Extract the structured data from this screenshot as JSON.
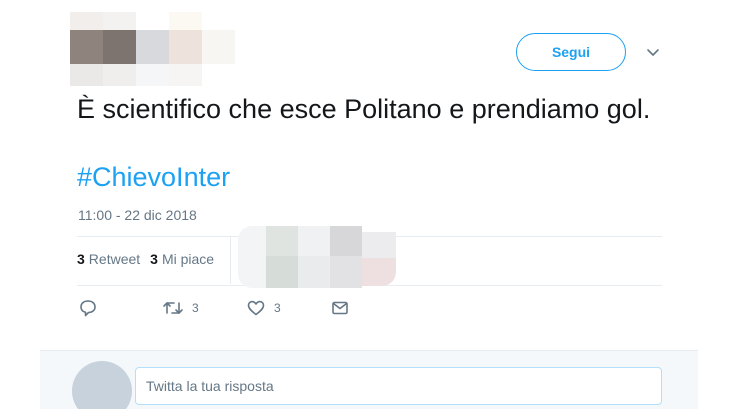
{
  "header": {
    "follow_label": "Segui",
    "caret_icon": "chevron-down-icon"
  },
  "tweet": {
    "text": "È scientifico che esce Politano e prendiamo gol.",
    "hashtag": "#ChievoInter",
    "timestamp": "11:00 - 22 dic 2018"
  },
  "stats": {
    "retweets_count": "3",
    "retweets_label": "Retweet",
    "likes_count": "3",
    "likes_label": "Mi piace"
  },
  "actions": {
    "reply_icon": "reply-icon",
    "retweet_icon": "retweet-icon",
    "retweet_count": "3",
    "like_icon": "heart-icon",
    "like_count": "3",
    "dm_icon": "envelope-icon"
  },
  "reply": {
    "placeholder": "Twitta la tua risposta"
  },
  "colors": {
    "accent": "#1da1f2",
    "text": "#14171a",
    "muted": "#657786",
    "divider": "#e6ecf0",
    "reply_bg": "#f5f8fa"
  }
}
